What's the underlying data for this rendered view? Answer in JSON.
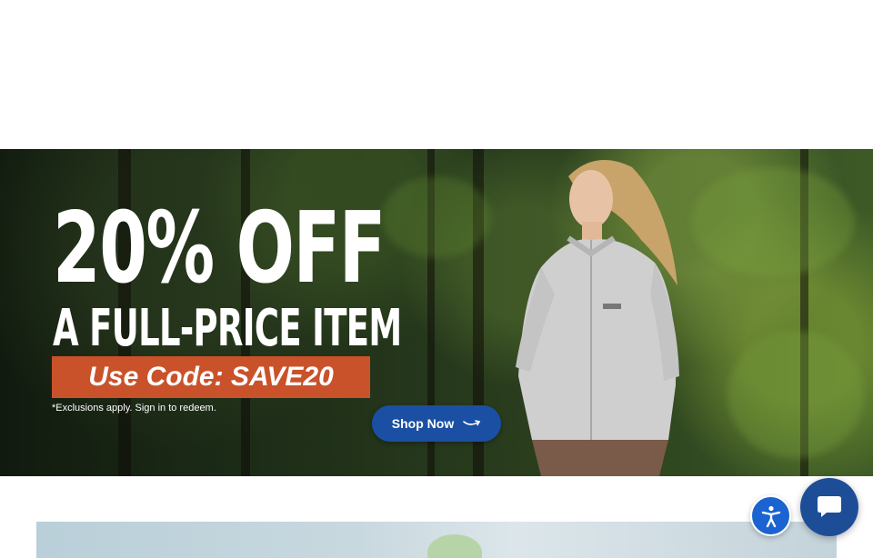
{
  "hero": {
    "headline": "20% OFF",
    "subheadline": "A FULL-PRICE ITEM",
    "promo_code": "Use Code: SAVE20",
    "fine_print": "*Exclusions apply. Sign in to redeem.",
    "cta_label": "Shop Now"
  },
  "widgets": {
    "accessibility_icon": "accessibility-icon",
    "chat_icon": "chat-bubble-icon"
  },
  "colors": {
    "promo_banner": "#c9522a",
    "cta_button": "#1a4fa3",
    "accessibility_button": "#1a63d1",
    "chat_button": "#1e4d98"
  }
}
